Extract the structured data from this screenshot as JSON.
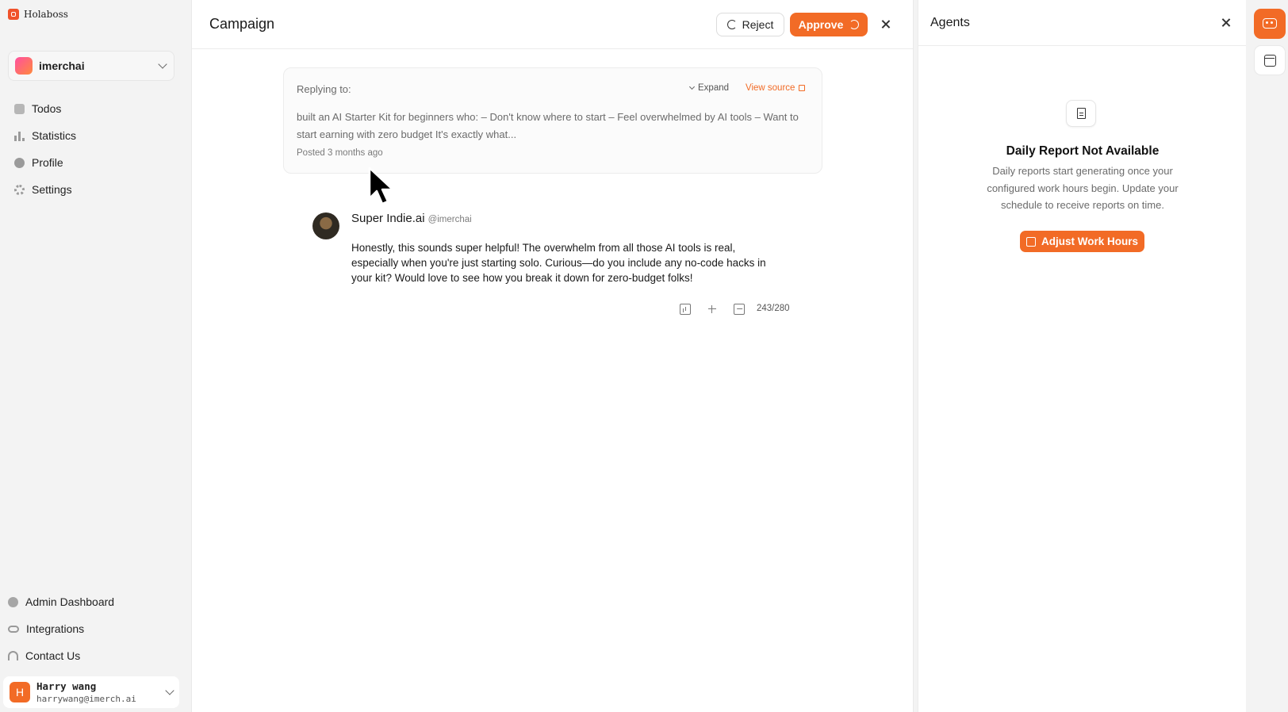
{
  "app": {
    "name": "Holaboss"
  },
  "workspace": {
    "name": "imerchai"
  },
  "nav": {
    "items": [
      {
        "label": "Todos",
        "icon": "todos-icon"
      },
      {
        "label": "Statistics",
        "icon": "statistics-icon"
      },
      {
        "label": "Profile",
        "icon": "profile-icon"
      },
      {
        "label": "Settings",
        "icon": "settings-icon"
      }
    ],
    "bottom": [
      {
        "label": "Admin Dashboard",
        "icon": "admin-icon"
      },
      {
        "label": "Integrations",
        "icon": "link-icon"
      },
      {
        "label": "Contact Us",
        "icon": "headset-icon"
      }
    ]
  },
  "user": {
    "initial": "H",
    "name": "Harry wang",
    "email": "harrywang@imerch.ai"
  },
  "campaign": {
    "title": "Campaign",
    "reject_label": "Reject",
    "approve_label": "Approve",
    "reply": {
      "label": "Replying to:",
      "expand_label": "Expand",
      "source_label": "View source",
      "text": "built an AI Starter Kit for beginners who: – Don't know where to start – Feel overwhelmed by AI tools – Want to start earning with zero budget It's exactly what...",
      "meta": "Posted 3 months ago"
    },
    "post": {
      "author": "Super Indie.ai",
      "handle": "@imerchai",
      "body": "Honestly, this sounds super helpful! The overwhelm from all those AI tools is real, especially when you're just starting solo. Curious—do you include any no-code hacks in your kit? Would love to see how you break it down for zero-budget folks!",
      "char_count": "243/280"
    }
  },
  "agents": {
    "title": "Agents",
    "report_title": "Daily Report Not Available",
    "report_desc": "Daily reports start generating once your configured work hours begin. Update your schedule to receive reports on time.",
    "adjust_label": "Adjust Work Hours"
  },
  "colors": {
    "accent": "#f26b26",
    "background": "#f3f3f3",
    "panel": "#ffffff"
  }
}
